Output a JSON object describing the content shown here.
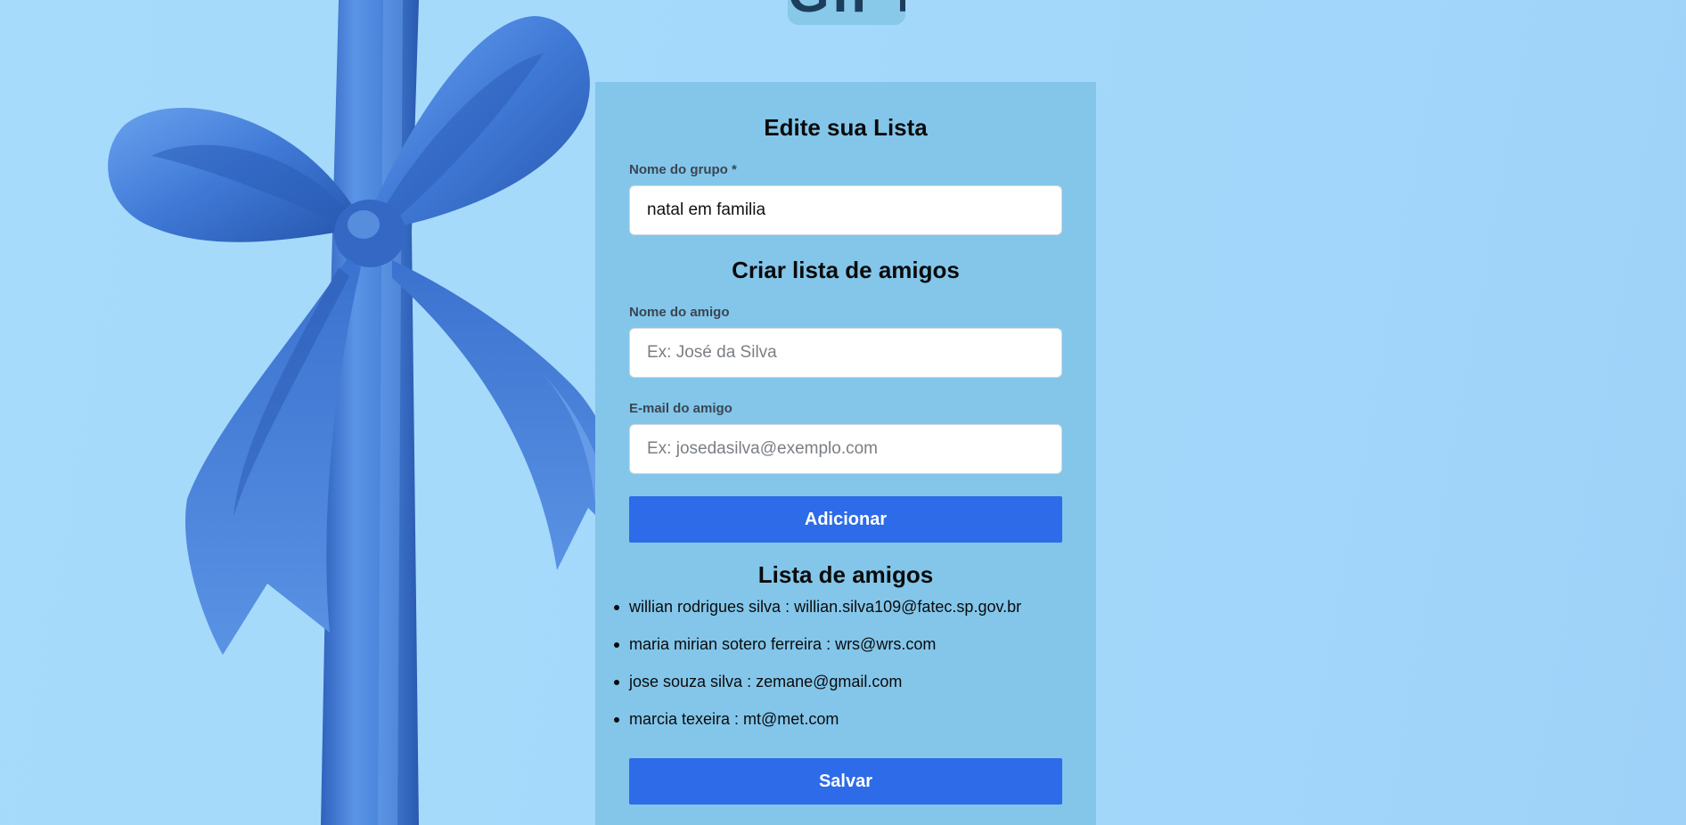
{
  "logo": {
    "text": "GIFT"
  },
  "edit_section": {
    "title": "Edite sua Lista",
    "group_name_label": "Nome do grupo *",
    "group_name_value": "natal em familia"
  },
  "create_section": {
    "title": "Criar lista de amigos",
    "friend_name_label": "Nome do amigo",
    "friend_name_placeholder": "Ex: José da Silva",
    "friend_email_label": "E-mail do amigo",
    "friend_email_placeholder": "Ex: josedasilva@exemplo.com",
    "add_button_label": "Adicionar"
  },
  "friends_section": {
    "title": "Lista de amigos",
    "items": [
      {
        "text": "willian rodrigues silva : willian.silva109@fatec.sp.gov.br"
      },
      {
        "text": "maria mirian sotero ferreira : wrs@wrs.com"
      },
      {
        "text": "jose souza silva : zemane@gmail.com"
      },
      {
        "text": "marcia texeira : mt@met.com"
      }
    ],
    "save_button_label": "Salvar"
  },
  "colors": {
    "background": "#a4d9fb",
    "panel": "#83c6ea",
    "primary_button": "#2d6be8",
    "ribbon": "#3f79d6"
  }
}
